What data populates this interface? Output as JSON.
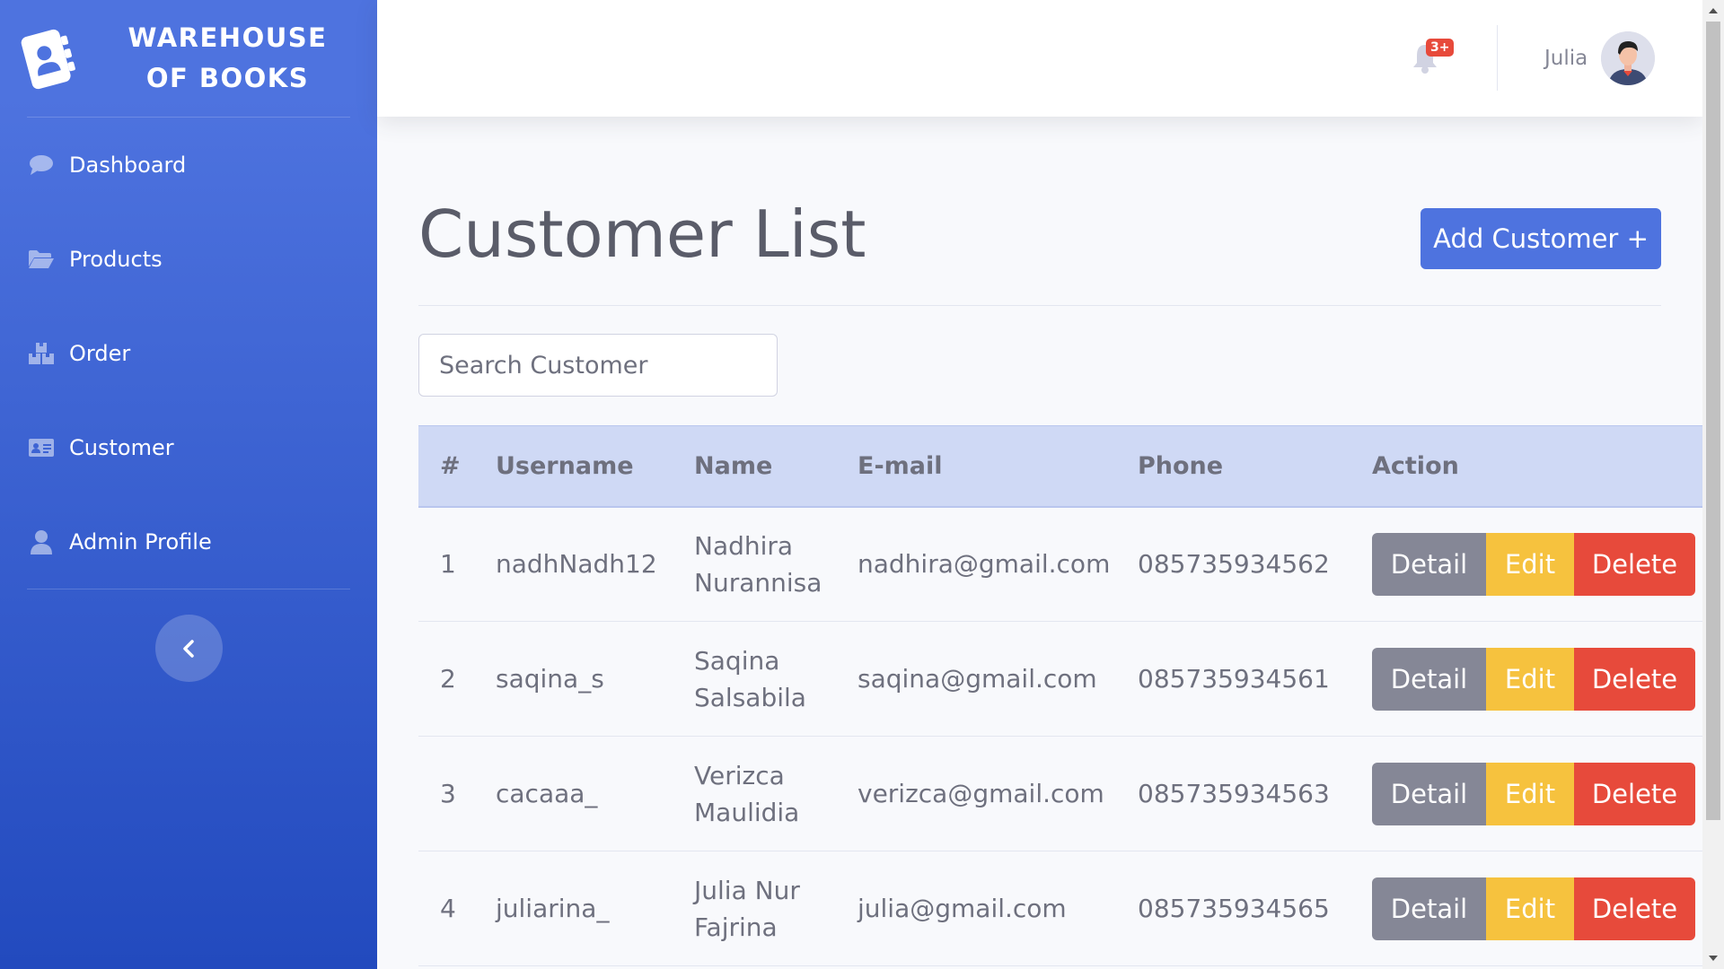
{
  "sidebar": {
    "brand": "WAREHOUSE OF BOOKS",
    "items": [
      {
        "label": "Dashboard",
        "icon": "comment-icon"
      },
      {
        "label": "Products",
        "icon": "folder-open-icon"
      },
      {
        "label": "Order",
        "icon": "boxes-icon"
      },
      {
        "label": "Customer",
        "icon": "id-card-icon"
      },
      {
        "label": "Admin Profile",
        "icon": "user-icon"
      }
    ],
    "toggle_icon": "chevron-left-icon"
  },
  "topbar": {
    "notification_count": "3+",
    "user_name": "Julia"
  },
  "main": {
    "title": "Customer List",
    "add_button": "Add Customer +",
    "search_placeholder": "Search Customer",
    "table": {
      "headers": [
        "#",
        "Username",
        "Name",
        "E-mail",
        "Phone",
        "Action"
      ],
      "rows": [
        {
          "num": "1",
          "username": "nadhNadh12",
          "name": "Nadhira Nurannisa",
          "email": "nadhira@gmail.com",
          "phone": "085735934562"
        },
        {
          "num": "2",
          "username": "saqina_s",
          "name": "Saqina Salsabila",
          "email": "saqina@gmail.com",
          "phone": "085735934561"
        },
        {
          "num": "3",
          "username": "cacaaa_",
          "name": "Verizca Maulidia",
          "email": "verizca@gmail.com",
          "phone": "085735934563"
        },
        {
          "num": "4",
          "username": "juliarina_",
          "name": "Julia Nur Fajrina",
          "email": "julia@gmail.com",
          "phone": "085735934565"
        }
      ],
      "actions": {
        "detail": "Detail",
        "edit": "Edit",
        "delete": "Delete"
      }
    }
  },
  "colors": {
    "primary": "#4e73df",
    "primary_dark": "#224abe",
    "secondary": "#858796",
    "warning": "#f6c23e",
    "danger": "#e74a3b",
    "table_header": "#cfd9f5"
  }
}
